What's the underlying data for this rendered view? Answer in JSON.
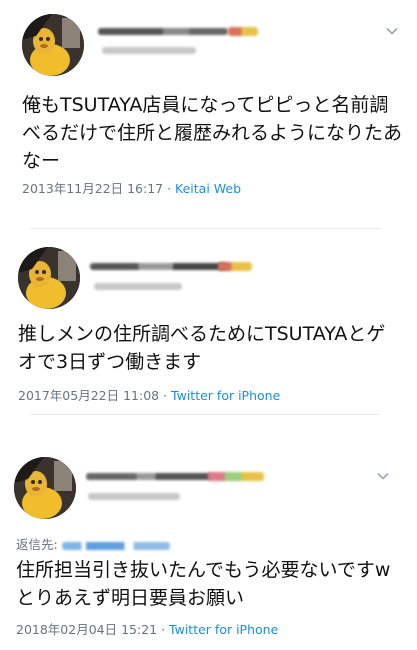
{
  "tweets": [
    {
      "text": "俺もTSUTAYA店員になってピピっと名前調べるだけで住所と履歴みれるようになりたあなー",
      "timestamp": "2013年11月22日 16:17",
      "separator": " · ",
      "source": "Keitai Web",
      "has_menu": true
    },
    {
      "text": "推しメンの住所調べるためにTSUTAYAとゲオで3日ずつ働きます",
      "timestamp": "2017年05月22日 11:08",
      "separator": " · ",
      "source": "Twitter for iPhone",
      "has_menu": false
    },
    {
      "reply_label": "返信先:",
      "text": "住所担当引き抜いたんでもう必要ないですwとりあえず明日要員お願い",
      "timestamp": "2018年02月04日 15:21",
      "separator": " · ",
      "source": "Twitter for iPhone",
      "has_menu": true
    }
  ],
  "colors": {
    "text": "#111111",
    "meta": "#66757f",
    "link": "#1d8ed8",
    "divider": "#eaeaea"
  },
  "icons": {
    "menu": "chevron-down-icon",
    "avatar": "avatar-image"
  }
}
